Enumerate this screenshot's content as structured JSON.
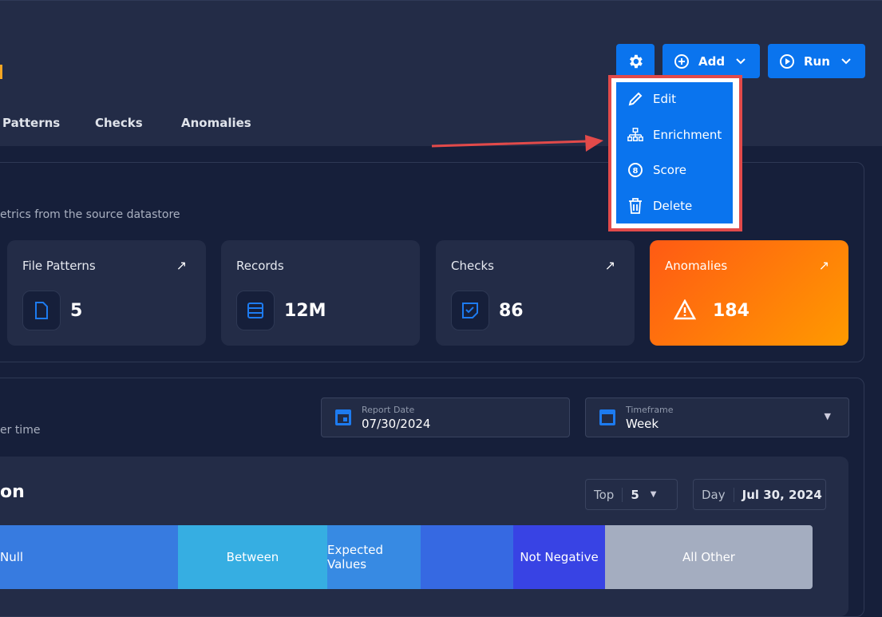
{
  "tabs": [
    "Patterns",
    "Checks",
    "Anomalies"
  ],
  "toolbar": {
    "add_label": "Add",
    "run_label": "Run"
  },
  "menu": {
    "items": [
      {
        "label": "Edit",
        "icon": "pencil-icon"
      },
      {
        "label": "Enrichment",
        "icon": "hierarchy-icon"
      },
      {
        "label": "Score",
        "icon": "score-icon"
      },
      {
        "label": "Delete",
        "icon": "trash-icon"
      }
    ]
  },
  "overview": {
    "subtitle": "etrics from the source datastore",
    "cards": [
      {
        "title": "File Patterns",
        "value": "5"
      },
      {
        "title": "Records",
        "value": "12M"
      },
      {
        "title": "Checks",
        "value": "86"
      },
      {
        "title": "Anomalies",
        "value": "184"
      }
    ]
  },
  "activity": {
    "subtitle": "er time",
    "report_date_label": "Report Date",
    "report_date": "07/30/2024",
    "timeframe_label": "Timeframe",
    "timeframe": "Week"
  },
  "distribution": {
    "title": "on",
    "top_label": "Top",
    "top_value": "5",
    "day_label": "Day",
    "day_value": "Jul 30, 2024",
    "segments": [
      {
        "label": "Null",
        "color": "#377be0"
      },
      {
        "label": "Between",
        "color": "#36aee2"
      },
      {
        "label": "Expected Values",
        "color": "#378ae3"
      },
      {
        "label": "",
        "color": "#3669e2"
      },
      {
        "label": "Not Negative",
        "color": "#3843e4"
      },
      {
        "label": "All Other",
        "color": "#a4adc0"
      }
    ]
  },
  "colors": {
    "accent": "#0a74ee",
    "highlight": "#e24a4a",
    "anomaly_from": "#ff5a14",
    "anomaly_to": "#ff9a00"
  }
}
